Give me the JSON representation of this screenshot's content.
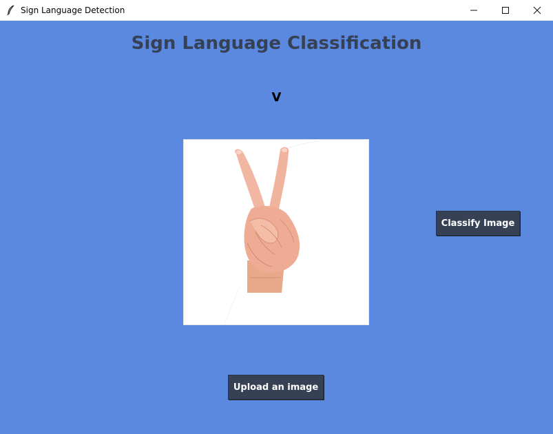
{
  "window": {
    "title": "Sign Language Detection"
  },
  "main": {
    "heading": "Sign Language Classification",
    "prediction": "V"
  },
  "buttons": {
    "classify_label": "Classify Image",
    "upload_label": "Upload an image"
  },
  "icons": {
    "app": "feather-icon",
    "minimize": "minimize-icon",
    "maximize": "maximize-icon",
    "close": "close-icon"
  },
  "colors": {
    "background": "#5b89e0",
    "heading_text": "#364156",
    "button_bg": "#364156",
    "button_text": "#ffffff"
  }
}
